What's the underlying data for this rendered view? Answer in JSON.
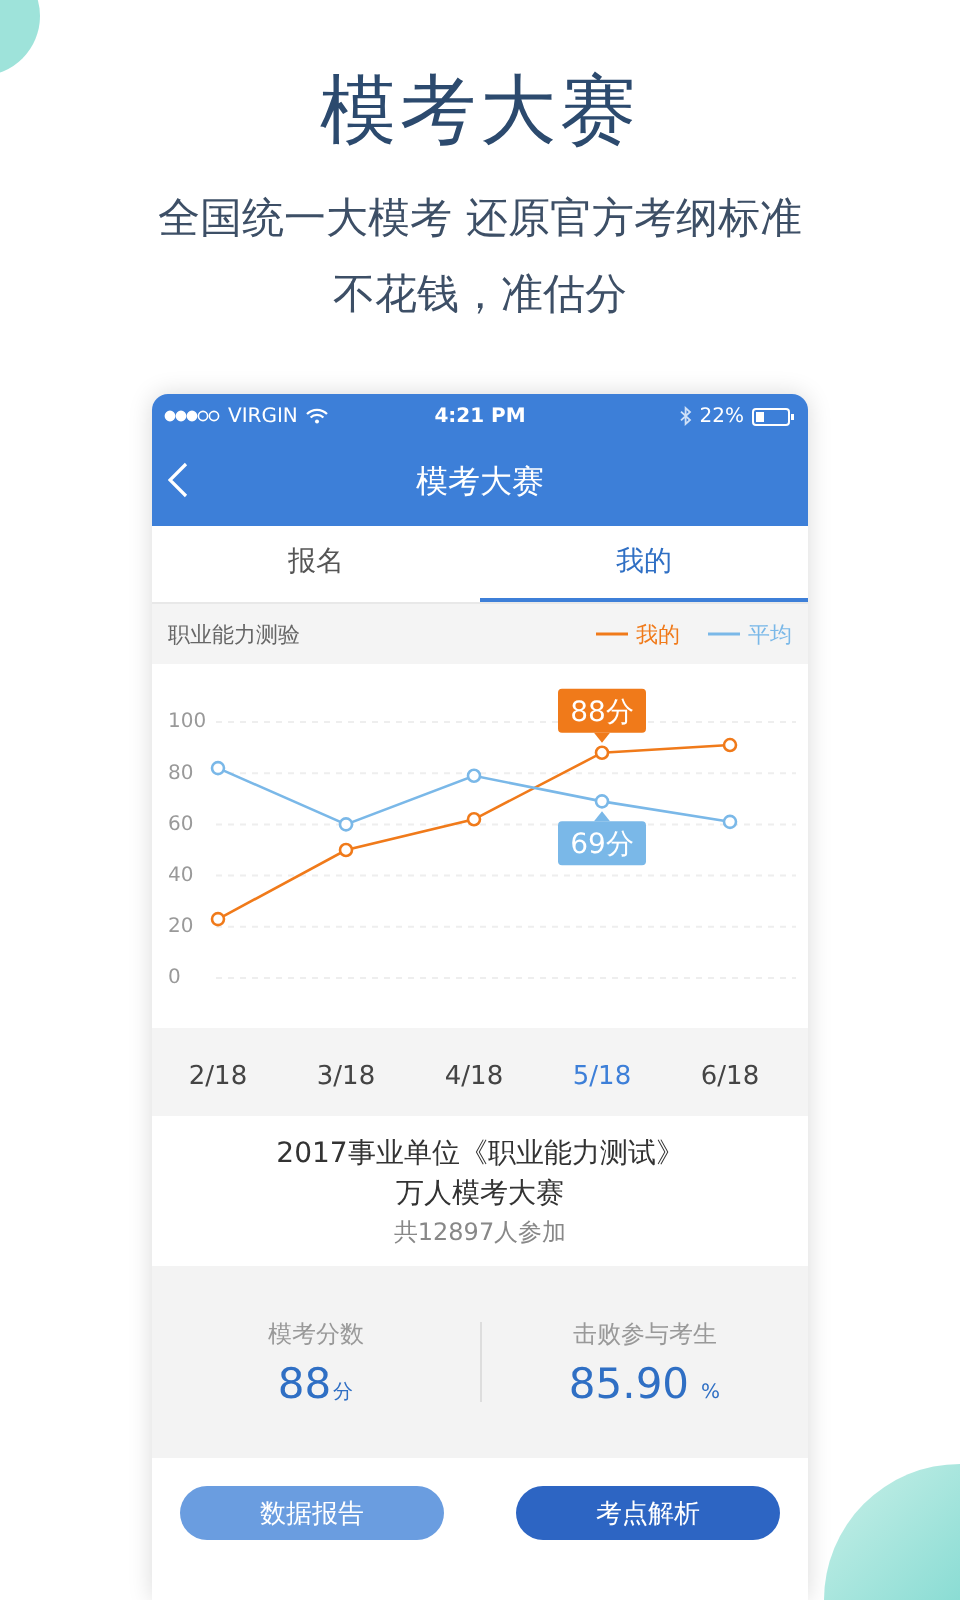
{
  "headline": "模考大赛",
  "tagline": [
    "全国统一大模考 还原官方考纲标准",
    "不花钱，准估分"
  ],
  "phone": {
    "status_bar": {
      "carrier": "VIRGIN",
      "time": "4:21 PM",
      "battery": "22%"
    },
    "nav": {
      "title": "模考大赛"
    },
    "tabs": [
      {
        "label": "报名",
        "selected": false
      },
      {
        "label": "我的",
        "selected": true
      }
    ],
    "chart_header": {
      "title": "职业能力测验"
    },
    "chart": {
      "chart_data": {
        "type": "line",
        "categories": [
          "2/18",
          "3/18",
          "4/18",
          "5/18",
          "6/18"
        ],
        "ylim": [
          0,
          100
        ],
        "yticks": [
          0,
          20,
          40,
          60,
          80,
          100
        ],
        "grid": true,
        "series": [
          {
            "name": "我的",
            "color": "#f07a1a",
            "marker": "circle",
            "values": [
              23,
              50,
              62,
              88,
              91
            ]
          },
          {
            "name": "平均",
            "color": "#7ab8e8",
            "marker": "circle",
            "values": [
              82,
              60,
              79,
              69,
              61
            ]
          }
        ],
        "annotations": [
          {
            "x": "5/18",
            "y": 88,
            "text": "88分"
          },
          {
            "x": "5/18",
            "y": 69,
            "text": "69分"
          }
        ]
      }
    },
    "contest": {
      "title": "2017事业单位《职业能力测试》",
      "subtitle": "万人模考大赛",
      "participants": "共12897人参加"
    },
    "stats": [
      {
        "label": "模考分数",
        "value": "88",
        "unit": "分"
      },
      {
        "label": "击败参与考生",
        "value": "85.90",
        "unit": "%"
      }
    ],
    "buttons": [
      {
        "label": "数据报告",
        "kind": "secondary"
      },
      {
        "label": "考点解析",
        "kind": "primary"
      }
    ]
  }
}
